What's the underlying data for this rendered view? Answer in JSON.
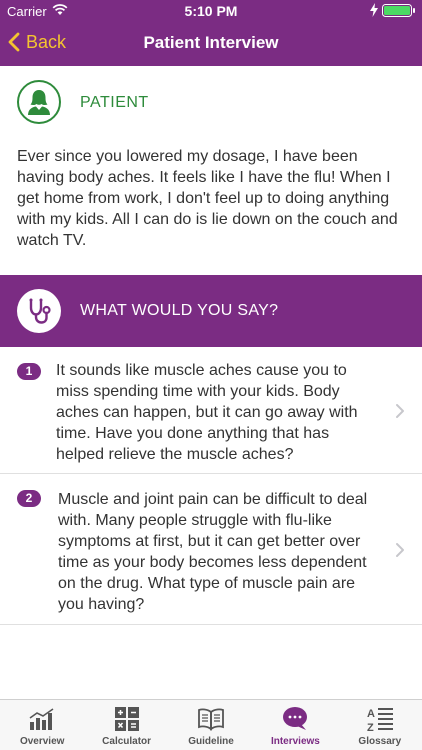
{
  "status": {
    "carrier": "Carrier",
    "time": "5:10 PM"
  },
  "nav": {
    "back_label": "Back",
    "title": "Patient Interview"
  },
  "patient": {
    "label": "PATIENT",
    "text": "Ever since you lowered my dosage, I have been having body aches. It feels like I have the flu! When I get home from work, I don't feel up to doing anything with my kids. All I can do is lie down on the couch and watch TV."
  },
  "question": {
    "label": "WHAT WOULD YOU SAY?"
  },
  "options": [
    {
      "number": "1",
      "text": "It sounds like muscle aches cause you to miss spending time with your kids. Body aches can happen, but it can go away with time. Have you done anything that has helped relieve the muscle aches?"
    },
    {
      "number": "2",
      "text": "Muscle and joint pain can be difficult to deal with. Many people struggle with flu-like symptoms at first, but it can get better over time as your body becomes less dependent on the drug. What type of muscle pain are you having?"
    }
  ],
  "tabs": [
    {
      "label": "Overview",
      "icon": "bar-chart-icon",
      "active": false
    },
    {
      "label": "Calculator",
      "icon": "calculator-icon",
      "active": false
    },
    {
      "label": "Guideline",
      "icon": "book-icon",
      "active": false
    },
    {
      "label": "Interviews",
      "icon": "chat-bubble-icon",
      "active": true
    },
    {
      "label": "Glossary",
      "icon": "glossary-icon",
      "active": false
    }
  ],
  "colors": {
    "brand_purple": "#7b2c83",
    "patient_green": "#2e8b3b",
    "back_yellow": "#f4c430",
    "battery_green": "#4cd964"
  }
}
